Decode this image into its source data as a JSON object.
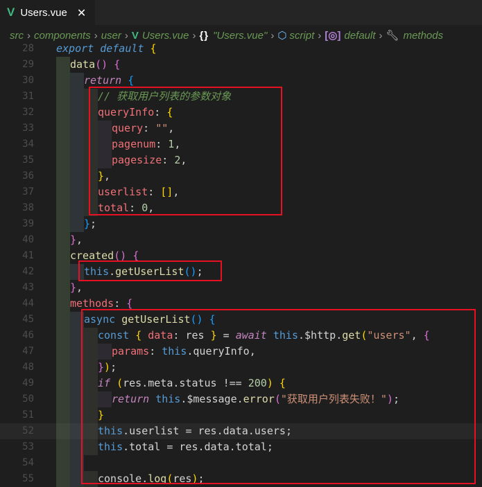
{
  "tab": {
    "icon": "vue-icon",
    "title": "Users.vue"
  },
  "breadcrumb": [
    "src",
    "components",
    "user",
    "Users.vue",
    "\"Users.vue\"",
    "script",
    "default",
    "methods"
  ],
  "line_numbers": [
    "28",
    "29",
    "30",
    "31",
    "32",
    "33",
    "34",
    "35",
    "36",
    "37",
    "38",
    "39",
    "40",
    "41",
    "42",
    "43",
    "44",
    "45",
    "46",
    "47",
    "48",
    "49",
    "50",
    "51",
    "52",
    "53",
    "54",
    "55"
  ],
  "code": {
    "l28": [
      "export default",
      "{"
    ],
    "l29": [
      "data",
      "()",
      "{"
    ],
    "l30": [
      "return",
      "{"
    ],
    "l31": [
      "// 获取用户列表的参数对象"
    ],
    "l32": [
      "queryInfo",
      ":",
      "{"
    ],
    "l33": [
      "query",
      ":",
      "\"\"",
      ","
    ],
    "l34": [
      "pagenum",
      ":",
      "1",
      ","
    ],
    "l35": [
      "pagesize",
      ":",
      "2",
      ","
    ],
    "l36": [
      "}",
      ","
    ],
    "l37": [
      "userlist",
      ":",
      "[]",
      ","
    ],
    "l38": [
      "total",
      ":",
      "0",
      ","
    ],
    "l39": [
      "}",
      ";"
    ],
    "l40": [
      "}",
      ","
    ],
    "l41": [
      "created",
      "()",
      "{"
    ],
    "l42": [
      "this",
      ".",
      "getUserList",
      "()",
      ";"
    ],
    "l43": [
      "}",
      ","
    ],
    "l44": [
      "methods",
      ":",
      "{"
    ],
    "l45": [
      "async",
      "getUserList",
      "()",
      "{"
    ],
    "l46": [
      "const",
      "{",
      "data",
      ":",
      "res",
      "}",
      "=",
      "await",
      "this",
      ".",
      "$http",
      ".",
      "get",
      "(",
      "\"users\"",
      ",",
      "{"
    ],
    "l47": [
      "params",
      ":",
      "this",
      ".",
      "queryInfo",
      ","
    ],
    "l48": [
      "}",
      ")",
      ";"
    ],
    "l49": [
      "if",
      "(",
      "res.meta.status",
      "!==",
      "200",
      ")",
      "{"
    ],
    "l50": [
      "return",
      "this",
      ".",
      "$message",
      ".",
      "error",
      "(",
      "\"获取用户列表失败！\"",
      ")",
      ";"
    ],
    "l51": [
      "}"
    ],
    "l52": [
      "this",
      ".",
      "userlist",
      "=",
      "res.data.users",
      ";"
    ],
    "l53": [
      "this",
      ".",
      "total",
      "=",
      "res.data.total",
      ";"
    ],
    "l54": [],
    "l55": [
      "console",
      ".",
      "log",
      "(",
      "res",
      ")",
      ";"
    ]
  },
  "colors": {
    "highlight_box": "#e81123",
    "keyword": "#569cd6",
    "string": "#ce9178",
    "number": "#b5cea8",
    "comment": "#6a9955",
    "function": "#dcdcaa"
  },
  "icons": {
    "tab": "vue-icon",
    "close": "close-icon",
    "braces": "braces-icon",
    "script": "cube-icon",
    "default": "module-icon",
    "methods": "wrench-icon"
  }
}
